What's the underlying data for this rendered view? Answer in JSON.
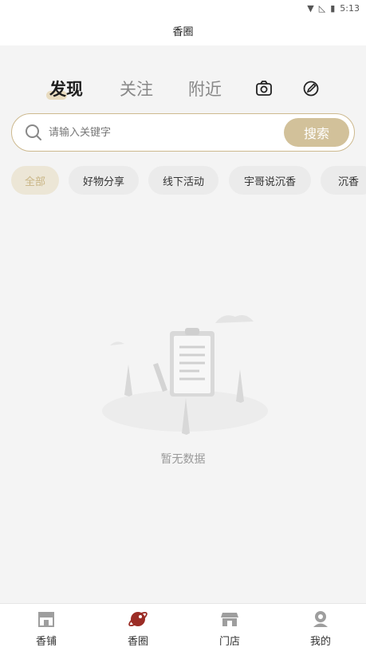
{
  "status_bar": {
    "time": "5:13"
  },
  "title": "香圈",
  "main_tabs": [
    {
      "label": "发现",
      "active": true
    },
    {
      "label": "关注",
      "active": false
    },
    {
      "label": "附近",
      "active": false
    }
  ],
  "tab_icons": [
    "camera-icon",
    "edit-icon"
  ],
  "search": {
    "placeholder": "请输入关键字",
    "button_label": "搜索"
  },
  "chips": [
    {
      "label": "全部",
      "active": true
    },
    {
      "label": "好物分享",
      "active": false
    },
    {
      "label": "线下活动",
      "active": false
    },
    {
      "label": "宇哥说沉香",
      "active": false
    },
    {
      "label": "沉香",
      "active": false
    }
  ],
  "empty": {
    "text": "暂无数据"
  },
  "bottom_nav": [
    {
      "label": "香铺",
      "icon": "shop-icon",
      "active": false
    },
    {
      "label": "香圈",
      "icon": "planet-icon",
      "active": true
    },
    {
      "label": "门店",
      "icon": "store-icon",
      "active": false
    },
    {
      "label": "我的",
      "icon": "profile-icon",
      "active": false
    }
  ],
  "colors": {
    "accent": "#d2c19a",
    "active_nav": "#9b2c25",
    "inactive_icon": "#9e9e9e"
  }
}
